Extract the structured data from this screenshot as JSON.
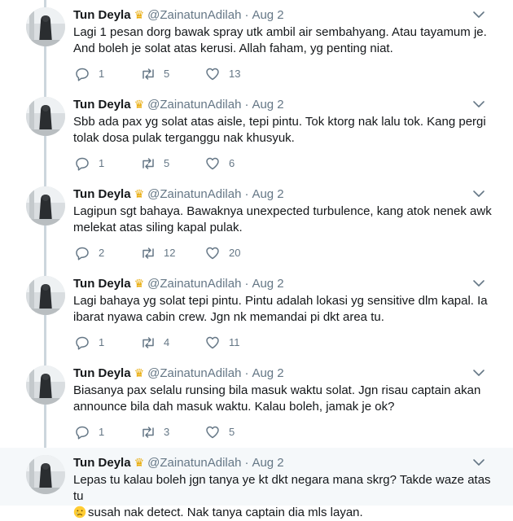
{
  "tweets": [
    {
      "name": "Tun Deyla",
      "badge_icon": "crown-emoji",
      "handle": "@ZainatunAdilah",
      "separator": "·",
      "date": "Aug 2",
      "text": "Lagi 1 pesan dorg bawak spray utk ambil air sembahyang. Atau tayamum je. And boleh je solat atas kerusi. Allah faham, yg penting niat.",
      "replies": "1",
      "retweets": "5",
      "likes": "13"
    },
    {
      "name": "Tun Deyla",
      "badge_icon": "crown-emoji",
      "handle": "@ZainatunAdilah",
      "separator": "·",
      "date": "Aug 2",
      "text": "Sbb ada pax yg solat atas aisle, tepi pintu. Tok ktorg nak lalu tok. Kang pergi tolak dosa pulak terganggu nak khusyuk.",
      "replies": "1",
      "retweets": "5",
      "likes": "6"
    },
    {
      "name": "Tun Deyla",
      "badge_icon": "crown-emoji",
      "handle": "@ZainatunAdilah",
      "separator": "·",
      "date": "Aug 2",
      "text": "Lagipun sgt bahaya. Bawaknya unexpected turbulence, kang atok nenek awk melekat atas siling kapal pulak.",
      "replies": "2",
      "retweets": "12",
      "likes": "20"
    },
    {
      "name": "Tun Deyla",
      "badge_icon": "crown-emoji",
      "handle": "@ZainatunAdilah",
      "separator": "·",
      "date": "Aug 2",
      "text": "Lagi bahaya yg solat tepi pintu. Pintu adalah lokasi yg sensitive dlm kapal. Ia ibarat nyawa cabin crew. Jgn nk memandai pi dkt area tu.",
      "replies": "1",
      "retweets": "4",
      "likes": "11"
    },
    {
      "name": "Tun Deyla",
      "badge_icon": "crown-emoji",
      "handle": "@ZainatunAdilah",
      "separator": "·",
      "date": "Aug 2",
      "text": "Biasanya pax selalu runsing bila masuk waktu solat. Jgn risau captain akan announce bila dah masuk waktu. Kalau boleh, jamak je ok?",
      "replies": "1",
      "retweets": "3",
      "likes": "5"
    },
    {
      "name": "Tun Deyla",
      "badge_icon": "crown-emoji",
      "handle": "@ZainatunAdilah",
      "separator": "·",
      "date": "Aug 2",
      "text_part1": "Lepas tu kalau boleh jgn tanya ye kt dkt negara mana skrg? Takde waze atas tu",
      "emoji_icon": "crying-face-emoji",
      "text_part2": "susah nak detect. Nak tanya captain dia mls layan."
    }
  ],
  "colors": {
    "text": "#14171a",
    "secondary": "#657786",
    "thread_line": "#ccd6dd",
    "highlight_bg": "#f5f8fa",
    "crown": "#e8a800"
  }
}
